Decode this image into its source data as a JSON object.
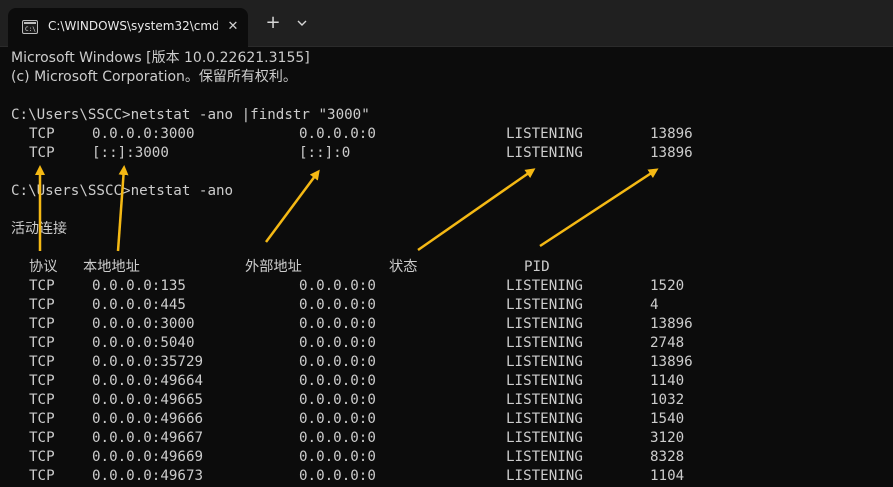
{
  "window": {
    "tab_title": "C:\\WINDOWS\\system32\\cmd.",
    "close_glyph": "✕",
    "new_tab_glyph": "+"
  },
  "console": {
    "banner_line1": "Microsoft Windows [版本 10.0.22621.3155]",
    "banner_line2": "(c) Microsoft Corporation。保留所有权利。",
    "cmd1": "C:\\Users\\SSCC>netstat -ano |findstr \"3000\"",
    "cmd2": "C:\\Users\\SSCC>netstat -ano",
    "section_title": "活动连接",
    "filtered_rows": [
      {
        "proto": "TCP",
        "local": "0.0.0.0:3000",
        "foreign": "0.0.0.0:0",
        "state": "LISTENING",
        "pid": "13896"
      },
      {
        "proto": "TCP",
        "local": "[::]:3000",
        "foreign": "[::]:0",
        "state": "LISTENING",
        "pid": "13896"
      }
    ],
    "headers": {
      "proto": "协议",
      "local": "本地地址",
      "foreign": "外部地址",
      "state": "状态",
      "pid": "PID"
    },
    "rows": [
      {
        "proto": "TCP",
        "local": "0.0.0.0:135",
        "foreign": "0.0.0.0:0",
        "state": "LISTENING",
        "pid": "1520"
      },
      {
        "proto": "TCP",
        "local": "0.0.0.0:445",
        "foreign": "0.0.0.0:0",
        "state": "LISTENING",
        "pid": "4"
      },
      {
        "proto": "TCP",
        "local": "0.0.0.0:3000",
        "foreign": "0.0.0.0:0",
        "state": "LISTENING",
        "pid": "13896"
      },
      {
        "proto": "TCP",
        "local": "0.0.0.0:5040",
        "foreign": "0.0.0.0:0",
        "state": "LISTENING",
        "pid": "2748"
      },
      {
        "proto": "TCP",
        "local": "0.0.0.0:35729",
        "foreign": "0.0.0.0:0",
        "state": "LISTENING",
        "pid": "13896"
      },
      {
        "proto": "TCP",
        "local": "0.0.0.0:49664",
        "foreign": "0.0.0.0:0",
        "state": "LISTENING",
        "pid": "1140"
      },
      {
        "proto": "TCP",
        "local": "0.0.0.0:49665",
        "foreign": "0.0.0.0:0",
        "state": "LISTENING",
        "pid": "1032"
      },
      {
        "proto": "TCP",
        "local": "0.0.0.0:49666",
        "foreign": "0.0.0.0:0",
        "state": "LISTENING",
        "pid": "1540"
      },
      {
        "proto": "TCP",
        "local": "0.0.0.0:49667",
        "foreign": "0.0.0.0:0",
        "state": "LISTENING",
        "pid": "3120"
      },
      {
        "proto": "TCP",
        "local": "0.0.0.0:49669",
        "foreign": "0.0.0.0:0",
        "state": "LISTENING",
        "pid": "8328"
      },
      {
        "proto": "TCP",
        "local": "0.0.0.0:49673",
        "foreign": "0.0.0.0:0",
        "state": "LISTENING",
        "pid": "1104"
      }
    ]
  },
  "annotation": {
    "arrow_color": "#f5b914"
  },
  "colors": {
    "background": "#0c0c0c",
    "text": "#cccccc",
    "titlebar": "#202020"
  }
}
